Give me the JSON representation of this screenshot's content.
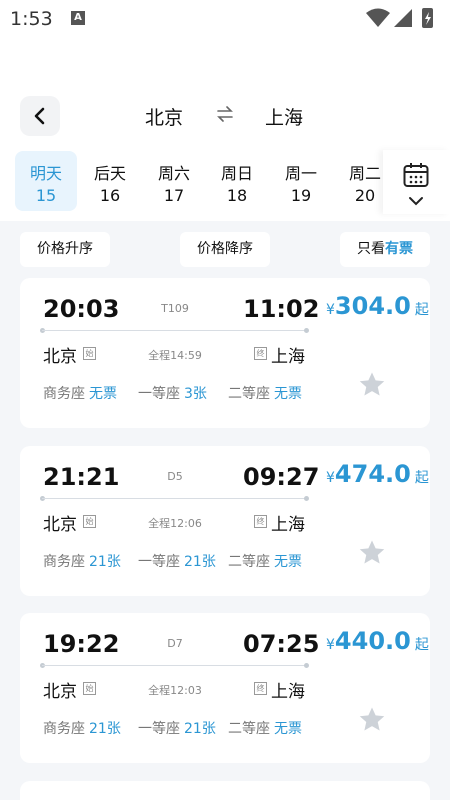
{
  "status": {
    "time": "1:53",
    "notification_icon": "A"
  },
  "header": {
    "from": "北京",
    "to": "上海",
    "swap_icon": "⇌"
  },
  "dates": [
    {
      "day": "明天",
      "date": "15",
      "active": true
    },
    {
      "day": "后天",
      "date": "16"
    },
    {
      "day": "周六",
      "date": "17"
    },
    {
      "day": "周日",
      "date": "18"
    },
    {
      "day": "周一",
      "date": "19"
    },
    {
      "day": "周二",
      "date": "20"
    }
  ],
  "sort": {
    "asc": "价格升序",
    "desc": "价格降序",
    "avail_prefix": "只看",
    "avail_highlight": "有票"
  },
  "trains": [
    {
      "train_no": "T109",
      "dep_time": "20:03",
      "arr_time": "11:02",
      "from_station": "北京",
      "to_station": "上海",
      "from_tag": "始",
      "to_tag": "终",
      "duration": "全程14:59",
      "price": "304.0",
      "currency": "¥",
      "price_suffix": "起",
      "seats": [
        {
          "name": "商务座",
          "value": "无票"
        },
        {
          "name": "一等座",
          "value": "3张"
        },
        {
          "name": "二等座",
          "value": "无票"
        }
      ]
    },
    {
      "train_no": "D5",
      "dep_time": "21:21",
      "arr_time": "09:27",
      "from_station": "北京",
      "to_station": "上海",
      "from_tag": "始",
      "to_tag": "终",
      "duration": "全程12:06",
      "price": "474.0",
      "currency": "¥",
      "price_suffix": "起",
      "seats": [
        {
          "name": "商务座",
          "value": "21张"
        },
        {
          "name": "一等座",
          "value": "21张"
        },
        {
          "name": "二等座",
          "value": "无票"
        }
      ]
    },
    {
      "train_no": "D7",
      "dep_time": "19:22",
      "arr_time": "07:25",
      "from_station": "北京",
      "to_station": "上海",
      "from_tag": "始",
      "to_tag": "终",
      "duration": "全程12:03",
      "price": "440.0",
      "currency": "¥",
      "price_suffix": "起",
      "seats": [
        {
          "name": "商务座",
          "value": "21张"
        },
        {
          "name": "一等座",
          "value": "21张"
        },
        {
          "name": "二等座",
          "value": "无票"
        }
      ]
    }
  ],
  "colors": {
    "accent": "#2b96d3",
    "background": "#f4f6f9",
    "card": "#ffffff"
  }
}
